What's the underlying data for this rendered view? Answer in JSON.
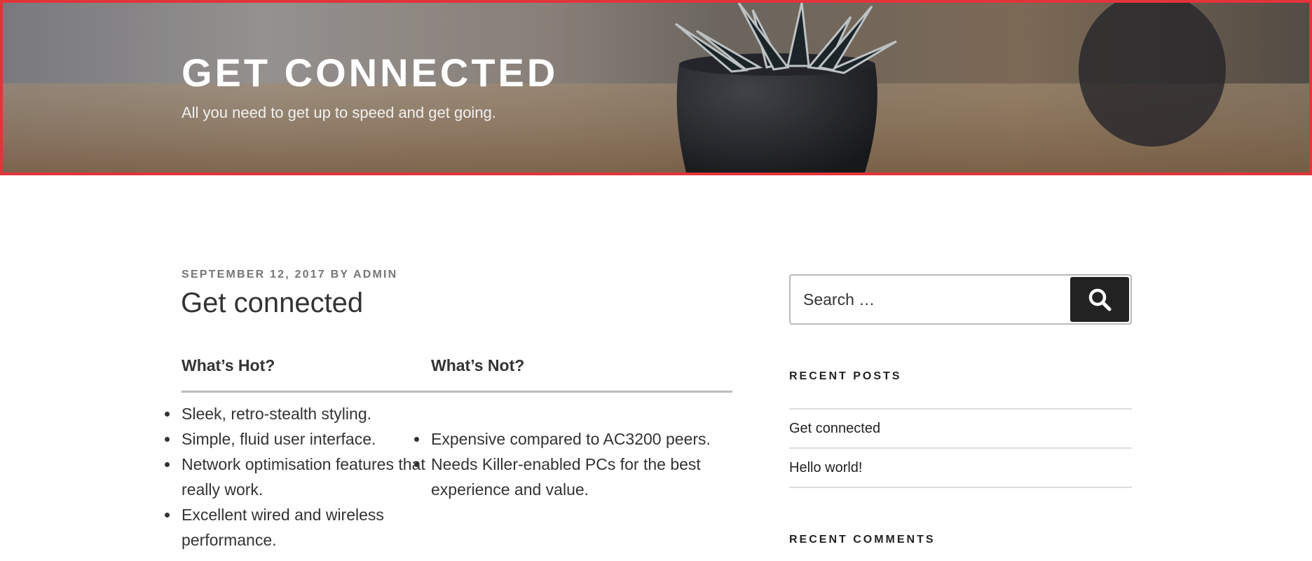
{
  "header": {
    "site_title": "GET CONNECTED",
    "site_description": "All you need to get up to speed and get going."
  },
  "post": {
    "date": "SEPTEMBER 12, 2017",
    "by": "BY",
    "author": "ADMIN",
    "title": "Get connected",
    "table": {
      "headers": [
        "What’s Hot?",
        "What’s Not?"
      ],
      "hot": [
        "Sleek, retro-stealth styling.",
        "Simple, fluid user interface.",
        "Network optimisation features that really work.",
        "Excellent wired and wireless performance."
      ],
      "not": [
        "Expensive compared to AC3200 peers.",
        "Needs Killer-enabled PCs for the best experience and value."
      ]
    }
  },
  "sidebar": {
    "search": {
      "placeholder": "Search …",
      "button_icon": "search-icon"
    },
    "recent_posts": {
      "title": "RECENT POSTS",
      "items": [
        "Get connected",
        "Hello world!"
      ]
    },
    "recent_comments": {
      "title": "RECENT COMMENTS"
    }
  },
  "colors": {
    "header_border": "#e2343a",
    "text": "#333333",
    "meta": "#767676",
    "search_button": "#222222"
  }
}
